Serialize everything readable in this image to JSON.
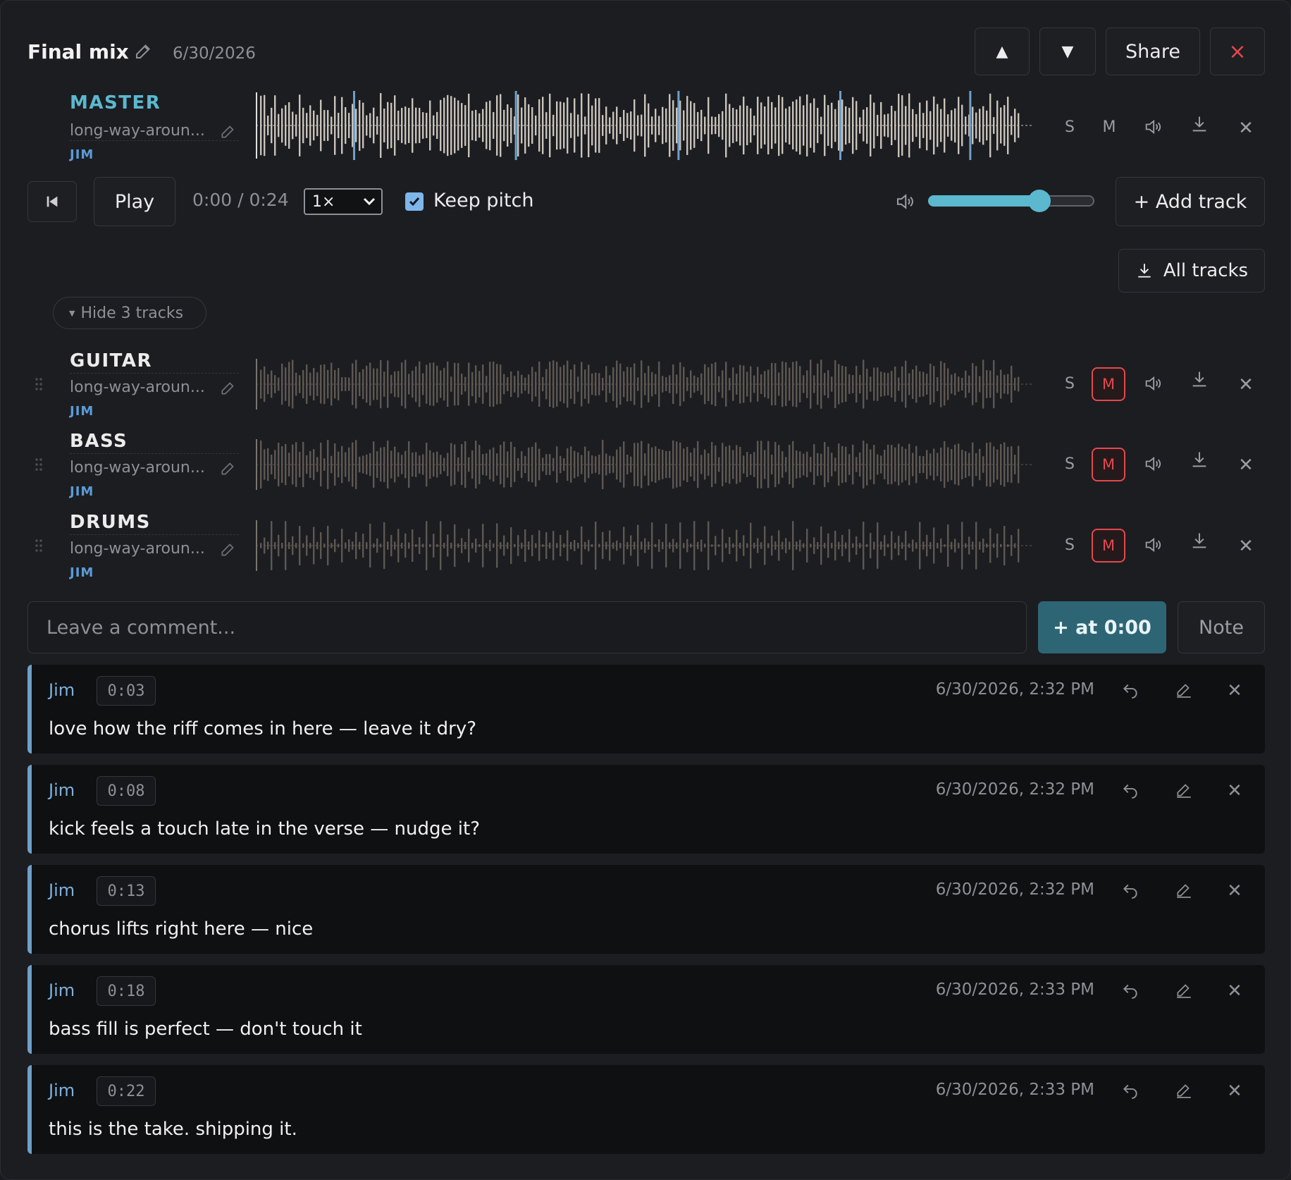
{
  "header": {
    "title": "Final mix",
    "date": "6/30/2026",
    "up_label": "▲",
    "down_label": "▼",
    "share_label": "Share",
    "close_label": "×"
  },
  "master": {
    "name": "MASTER",
    "file": "long-way-aroun...",
    "user": "JIM",
    "solo": "S",
    "mute": "M"
  },
  "transport": {
    "play_label": "Play",
    "time": "0:00 / 0:24",
    "speed": "1×",
    "keep_pitch_label": "Keep pitch",
    "keep_pitch_checked": true,
    "volume": 0.67,
    "add_track_label": "+ Add track",
    "all_tracks_label": "All tracks"
  },
  "tracks_toggle": "Hide 3 tracks",
  "tracks": [
    {
      "name": "GUITAR",
      "file": "long-way-aroun...",
      "user": "JIM",
      "solo": "S",
      "mute": "M",
      "muted": true
    },
    {
      "name": "BASS",
      "file": "long-way-aroun...",
      "user": "JIM",
      "solo": "S",
      "mute": "M",
      "muted": true
    },
    {
      "name": "DRUMS",
      "file": "long-way-aroun...",
      "user": "JIM",
      "solo": "S",
      "mute": "M",
      "muted": true
    }
  ],
  "comment_box": {
    "placeholder": "Leave a comment...",
    "add_at_label": "+ at 0:00",
    "note_label": "Note"
  },
  "comments": [
    {
      "author": "Jim",
      "time": "0:03",
      "date": "6/30/2026, 2:32 PM",
      "text": "love how the riff comes in here — leave it dry?"
    },
    {
      "author": "Jim",
      "time": "0:08",
      "date": "6/30/2026, 2:32 PM",
      "text": "kick feels a touch late in the verse — nudge it?"
    },
    {
      "author": "Jim",
      "time": "0:13",
      "date": "6/30/2026, 2:32 PM",
      "text": "chorus lifts right here — nice"
    },
    {
      "author": "Jim",
      "time": "0:18",
      "date": "6/30/2026, 2:33 PM",
      "text": "bass fill is perfect — don't touch it"
    },
    {
      "author": "Jim",
      "time": "0:22",
      "date": "6/30/2026, 2:33 PM",
      "text": "this is the take. shipping it."
    }
  ],
  "colors": {
    "accent": "#5bb8cf",
    "mute": "#e5484d",
    "comment_bar": "#6f9fc8",
    "wave_master": "#c9c3ba",
    "wave_track": "#5e5852"
  }
}
